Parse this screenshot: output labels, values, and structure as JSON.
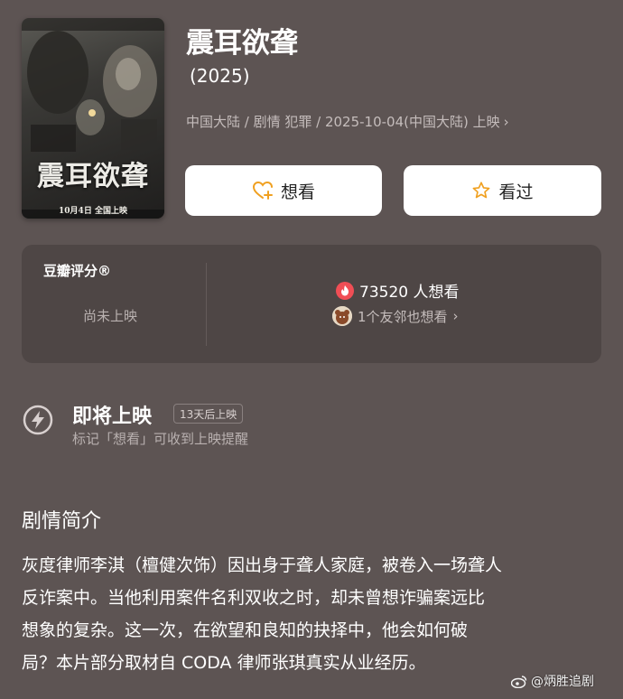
{
  "movie": {
    "poster": {
      "title": "震耳欲聋",
      "release_text": "10月4日 全国上映"
    },
    "title": "震耳欲聋",
    "year": "(2025)",
    "meta": "中国大陆 / 剧情 犯罪 / 2025-10-04(中国大陆) 上映"
  },
  "actions": {
    "want_label": "想看",
    "seen_label": "看过"
  },
  "rating": {
    "label": "豆瓣评分®",
    "status": "尚未上映",
    "wish_count": "73520 人想看",
    "friends_text": "1个友邻也想看"
  },
  "upcoming": {
    "title": "即将上映",
    "badge": "13天后上映",
    "hint": "标记「想看」可收到上映提醒"
  },
  "intro": {
    "heading": "剧情简介",
    "lines": [
      "灰度律师李淇（檀健次饰）因出身于聋人家庭，被卷入一场聋人",
      "反诈案中。当他利用案件名利双收之时，却未曾想诈骗案远比",
      "想象的复杂。这一次，在欲望和良知的抉择中，他会如何破",
      "局？本片部分取材自 CODA 律师张琪真实从业经历。"
    ]
  },
  "watermark": "@炳胜追剧",
  "colors": {
    "background": "#5d5453",
    "card": "#4e4645",
    "accent_orange": "#f0a020",
    "heart_red": "#f04e55"
  }
}
